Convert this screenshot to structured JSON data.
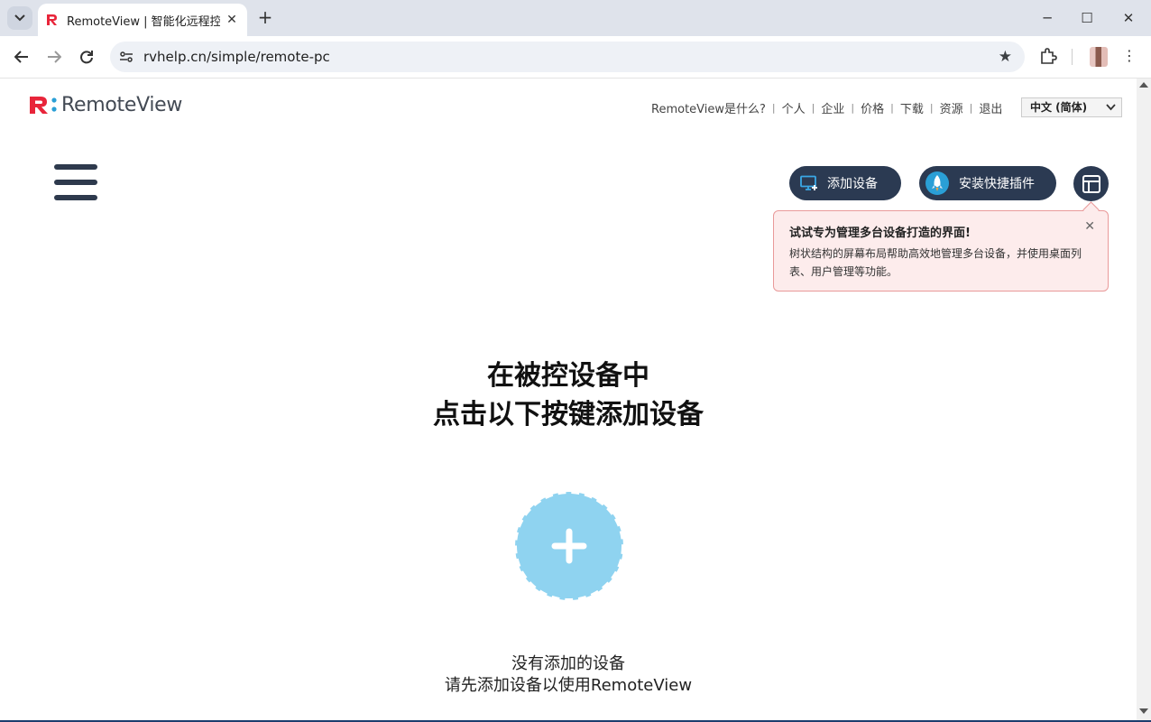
{
  "browser": {
    "tab_title": "RemoteView | 智能化远程控制",
    "tab_close": "✕",
    "new_tab": "+",
    "url": "rvhelp.cn/simple/remote-pc",
    "window_controls": {
      "minimize": "─",
      "maximize": "☐",
      "close": "✕"
    },
    "kebab": "⋮"
  },
  "header": {
    "logo_text": "RemoteView",
    "nav": [
      "RemoteView是什么?",
      "个人",
      "企业",
      "价格",
      "下载",
      "资源",
      "退出"
    ],
    "nav_separator": "|",
    "language": "中文 (简体)"
  },
  "toolbar": {
    "add_device_label": "添加设备",
    "install_plugin_label": "安装快捷插件"
  },
  "tooltip": {
    "title": "试试专为管理多台设备打造的界面!",
    "body": "树状结构的屏幕布局帮助高效地管理多台设备，并使用桌面列表、用户管理等功能。",
    "close": "✕"
  },
  "main": {
    "headline_line1": "在被控设备中",
    "headline_line2": "点击以下按键添加设备",
    "empty_line1": "没有添加的设备",
    "empty_line2": "请先添加设备以使用RemoteView"
  },
  "colors": {
    "brand_red": "#e8253a",
    "brand_blue": "#2a9fd6",
    "button_dark": "#2b3a52",
    "add_circle": "#8fd3f0",
    "tooltip_bg": "#fdecec",
    "tooltip_border": "#e99a9a"
  },
  "icons": {
    "tab_menu": "chevron-down-icon",
    "back": "arrow-left-icon",
    "forward": "arrow-right-icon",
    "reload": "reload-icon",
    "site_info": "site-settings-icon",
    "bookmark": "star-icon",
    "extensions": "puzzle-icon",
    "add_device": "monitor-plus-icon",
    "plugin": "rocket-icon",
    "layout": "layout-icon",
    "add_big": "plus-icon"
  }
}
